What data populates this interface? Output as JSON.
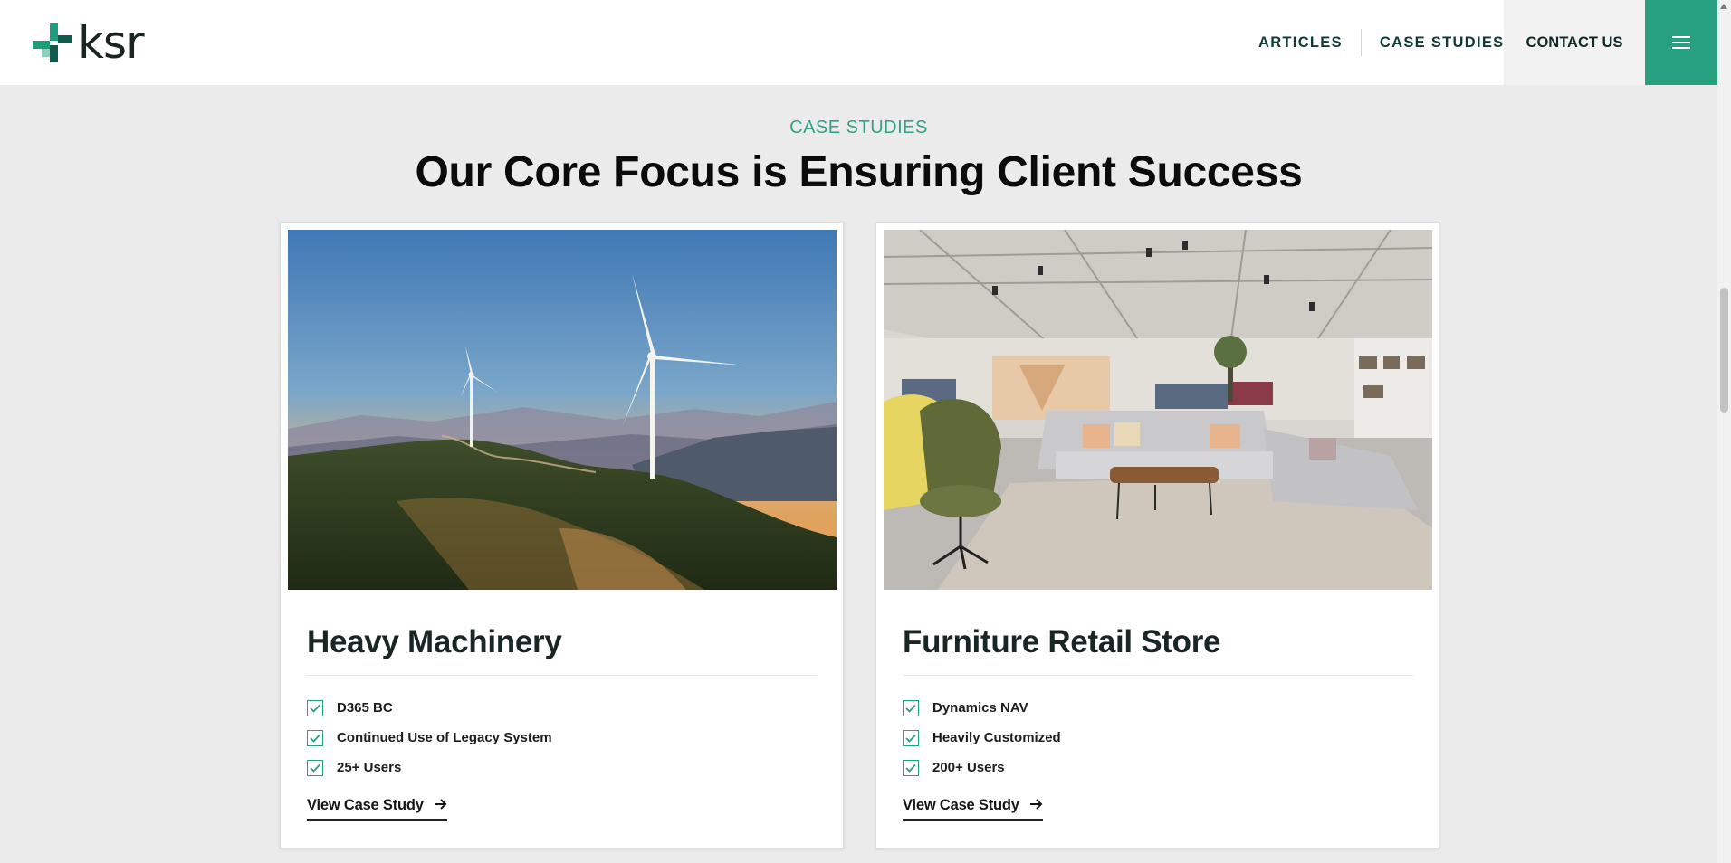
{
  "header": {
    "logo_text": "ksr",
    "nav": [
      {
        "label": "ARTICLES"
      },
      {
        "label": "CASE STUDIES"
      }
    ],
    "contact_label": "CONTACT US",
    "menu_icon": "hamburger-menu-icon",
    "colors": {
      "accent": "#27a07f",
      "dark_green": "#0f5a4d",
      "light_green": "#8ecfbc"
    }
  },
  "section": {
    "eyebrow": "CASE STUDIES",
    "title": "Our Core Focus is Ensuring Client Success"
  },
  "cards": [
    {
      "image": "wind-turbines-on-mountain-ridge-at-sunset",
      "title": "Heavy Machinery",
      "features": [
        "D365 BC",
        "Continued Use of Legacy System",
        "25+ Users"
      ],
      "cta": "View Case Study"
    },
    {
      "image": "furniture-showroom-with-sofas-and-armchairs",
      "title": "Furniture Retail Store",
      "features": [
        "Dynamics NAV",
        "Heavily Customized",
        "200+ Users"
      ],
      "cta": "View Case Study"
    }
  ],
  "icons": {
    "check": "checkbox-checked-icon",
    "arrow": "arrow-right-icon"
  }
}
